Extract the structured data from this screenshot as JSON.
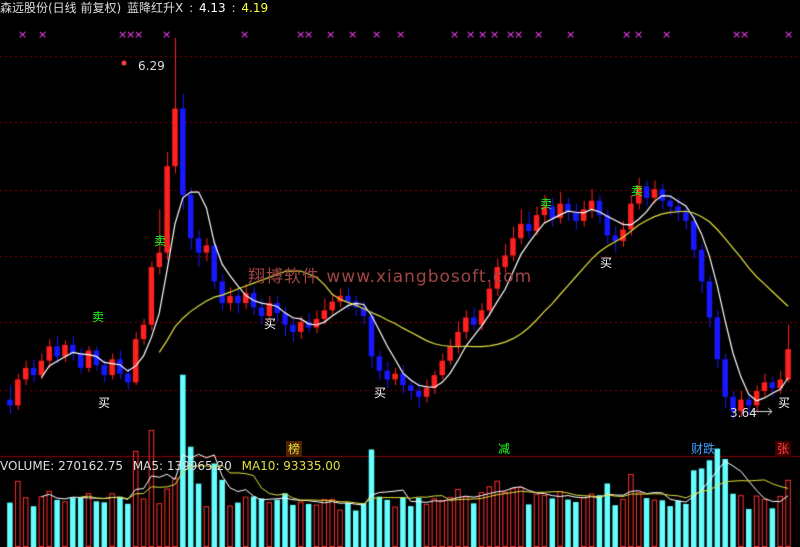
{
  "header": {
    "title": "森远股份(日线 前复权)",
    "indicator": "蓝降红升X",
    "sep": ":",
    "val1": "4.13",
    "val2": "4.19"
  },
  "watermark": "翔博软件 www.xiangbosoft.com",
  "annotations": {
    "high_label": "6.29",
    "low_label": "3.64",
    "buy": "买",
    "sell": "卖"
  },
  "event_tags": [
    "榜",
    "减",
    "财跌",
    "张"
  ],
  "volume_header": {
    "volume": "VOLUME: 270162.75",
    "ma5": "MA5: 139965.20",
    "ma10": "MA10: 93335.00"
  },
  "colors": {
    "up": "#ff2020",
    "down": "#1818ff",
    "ma_short": "#ffffff",
    "ma_long": "#e0e040",
    "buy_text": "#ffffff",
    "sell_text": "#20ff20",
    "marker": "#ff40ff",
    "grid": "#7a0000",
    "vol_cyan": "#6ff",
    "vol_up": "#ff3030"
  },
  "chart_data": {
    "type": "candlestick",
    "price_range": [
      3.5,
      6.4
    ],
    "high": 6.29,
    "low": 3.64,
    "candles": [
      [
        3.78,
        3.74,
        3.88,
        3.68
      ],
      [
        3.74,
        3.92,
        3.96,
        3.71
      ],
      [
        3.92,
        4.0,
        4.05,
        3.88
      ],
      [
        4.0,
        3.95,
        4.06,
        3.9
      ],
      [
        3.95,
        4.05,
        4.1,
        3.92
      ],
      [
        4.05,
        4.15,
        4.2,
        4.0
      ],
      [
        4.15,
        4.08,
        4.22,
        4.03
      ],
      [
        4.08,
        4.16,
        4.19,
        4.04
      ],
      [
        4.16,
        4.1,
        4.22,
        4.05
      ],
      [
        4.1,
        4.0,
        4.14,
        3.96
      ],
      [
        4.0,
        4.12,
        4.15,
        3.97
      ],
      [
        4.12,
        4.02,
        4.15,
        3.98
      ],
      [
        4.02,
        3.95,
        4.06,
        3.9
      ],
      [
        3.95,
        4.06,
        4.1,
        3.92
      ],
      [
        4.06,
        3.96,
        4.12,
        3.92
      ],
      [
        3.96,
        3.9,
        4.0,
        3.85
      ],
      [
        3.9,
        4.2,
        4.25,
        3.88
      ],
      [
        4.2,
        4.3,
        4.34,
        4.16
      ],
      [
        4.3,
        4.7,
        4.74,
        4.26
      ],
      [
        4.7,
        4.8,
        5.1,
        4.65
      ],
      [
        4.8,
        5.4,
        5.5,
        4.75
      ],
      [
        5.4,
        5.8,
        6.29,
        5.35
      ],
      [
        5.8,
        5.2,
        5.9,
        5.1
      ],
      [
        5.2,
        4.9,
        5.25,
        4.82
      ],
      [
        4.9,
        4.8,
        4.96,
        4.7
      ],
      [
        4.8,
        4.85,
        4.9,
        4.74
      ],
      [
        4.85,
        4.6,
        4.88,
        4.55
      ],
      [
        4.6,
        4.45,
        4.65,
        4.4
      ],
      [
        4.45,
        4.5,
        4.56,
        4.4
      ],
      [
        4.5,
        4.45,
        4.54,
        4.38
      ],
      [
        4.45,
        4.52,
        4.58,
        4.41
      ],
      [
        4.52,
        4.42,
        4.56,
        4.37
      ],
      [
        4.42,
        4.36,
        4.48,
        4.3
      ],
      [
        4.36,
        4.45,
        4.5,
        4.33
      ],
      [
        4.45,
        4.38,
        4.5,
        4.32
      ],
      [
        4.38,
        4.3,
        4.42,
        4.22
      ],
      [
        4.3,
        4.25,
        4.35,
        4.18
      ],
      [
        4.25,
        4.32,
        4.36,
        4.2
      ],
      [
        4.32,
        4.28,
        4.38,
        4.24
      ],
      [
        4.28,
        4.34,
        4.4,
        4.24
      ],
      [
        4.34,
        4.4,
        4.48,
        4.3
      ],
      [
        4.4,
        4.46,
        4.52,
        4.36
      ],
      [
        4.46,
        4.5,
        4.55,
        4.42
      ],
      [
        4.5,
        4.46,
        4.56,
        4.4
      ],
      [
        4.46,
        4.42,
        4.5,
        4.36
      ],
      [
        4.42,
        4.36,
        4.46,
        4.3
      ],
      [
        4.36,
        4.08,
        4.4,
        4.0
      ],
      [
        4.08,
        3.98,
        4.12,
        3.92
      ],
      [
        3.98,
        3.92,
        4.04,
        3.86
      ],
      [
        3.92,
        3.96,
        4.0,
        3.88
      ],
      [
        3.96,
        3.88,
        4.02,
        3.82
      ],
      [
        3.88,
        3.84,
        3.92,
        3.78
      ],
      [
        3.84,
        3.8,
        3.9,
        3.72
      ],
      [
        3.8,
        3.86,
        3.92,
        3.76
      ],
      [
        3.86,
        3.95,
        3.98,
        3.82
      ],
      [
        3.95,
        4.05,
        4.1,
        3.92
      ],
      [
        4.05,
        4.15,
        4.2,
        4.02
      ],
      [
        4.15,
        4.25,
        4.32,
        4.1
      ],
      [
        4.25,
        4.35,
        4.4,
        4.2
      ],
      [
        4.35,
        4.3,
        4.42,
        4.26
      ],
      [
        4.3,
        4.4,
        4.45,
        4.26
      ],
      [
        4.4,
        4.55,
        4.6,
        4.36
      ],
      [
        4.55,
        4.7,
        4.76,
        4.5
      ],
      [
        4.7,
        4.78,
        4.86,
        4.66
      ],
      [
        4.78,
        4.9,
        4.98,
        4.74
      ],
      [
        4.9,
        5.0,
        5.1,
        4.86
      ],
      [
        5.0,
        4.95,
        5.08,
        4.9
      ],
      [
        4.95,
        5.06,
        5.12,
        4.92
      ],
      [
        5.06,
        5.12,
        5.2,
        5.0
      ],
      [
        5.12,
        5.04,
        5.18,
        4.98
      ],
      [
        5.04,
        5.14,
        5.22,
        5.0
      ],
      [
        5.14,
        5.08,
        5.18,
        5.02
      ],
      [
        5.08,
        5.02,
        5.14,
        4.96
      ],
      [
        5.02,
        5.1,
        5.16,
        4.98
      ],
      [
        5.1,
        5.16,
        5.24,
        5.04
      ],
      [
        5.16,
        5.06,
        5.2,
        5.0
      ],
      [
        5.06,
        4.92,
        5.1,
        4.86
      ],
      [
        4.92,
        4.88,
        4.98,
        4.8
      ],
      [
        4.88,
        4.96,
        5.02,
        4.84
      ],
      [
        4.96,
        5.14,
        5.2,
        4.92
      ],
      [
        5.14,
        5.26,
        5.32,
        5.1
      ],
      [
        5.26,
        5.18,
        5.3,
        5.12
      ],
      [
        5.18,
        5.24,
        5.3,
        5.14
      ],
      [
        5.24,
        5.16,
        5.28,
        5.1
      ],
      [
        5.16,
        5.12,
        5.2,
        5.06
      ],
      [
        5.12,
        5.08,
        5.18,
        5.02
      ],
      [
        5.08,
        5.02,
        5.12,
        4.96
      ],
      [
        5.02,
        4.82,
        5.06,
        4.76
      ],
      [
        4.82,
        4.6,
        4.86,
        4.52
      ],
      [
        4.6,
        4.35,
        4.64,
        4.28
      ],
      [
        4.35,
        4.06,
        4.4,
        4.0
      ],
      [
        4.06,
        3.8,
        4.1,
        3.72
      ],
      [
        3.8,
        3.7,
        3.84,
        3.64
      ],
      [
        3.7,
        3.78,
        3.84,
        3.66
      ],
      [
        3.78,
        3.74,
        3.82,
        3.68
      ],
      [
        3.74,
        3.84,
        3.88,
        3.7
      ],
      [
        3.84,
        3.9,
        3.96,
        3.8
      ],
      [
        3.9,
        3.86,
        3.94,
        3.8
      ],
      [
        3.86,
        3.92,
        3.98,
        3.82
      ],
      [
        3.92,
        4.13,
        4.3,
        3.9
      ]
    ]
  }
}
